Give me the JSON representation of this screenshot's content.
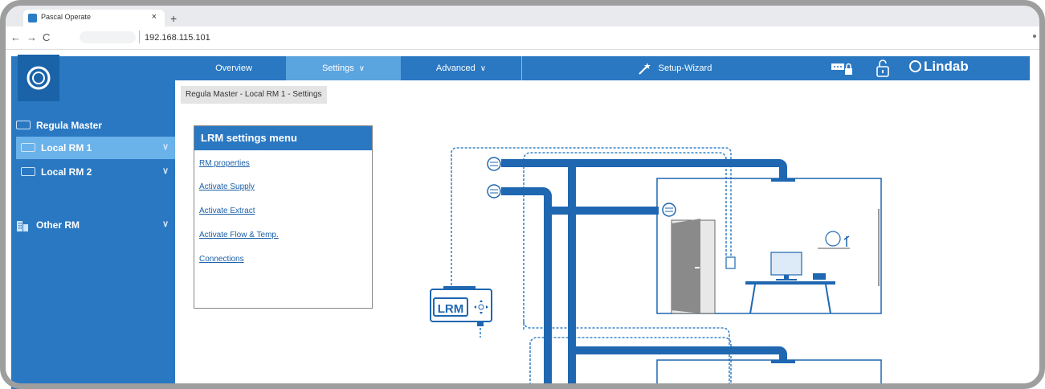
{
  "browser": {
    "tab_title": "Pascal Operate",
    "tab_close": "×",
    "new_tab": "+",
    "back": "←",
    "forward": "→",
    "reload": "C",
    "url": "192.168.115.101"
  },
  "topnav": {
    "items": [
      {
        "label": "Overview"
      },
      {
        "label": "Settings",
        "chevron": "∨"
      },
      {
        "label": "Advanced",
        "chevron": "∨"
      },
      {
        "label": "Setup-Wizard"
      }
    ],
    "brand": "Lindab"
  },
  "sidebar": {
    "master": "Regula Master",
    "items": [
      {
        "label": "Local RM 1",
        "chevron": "∨"
      },
      {
        "label": "Local RM 2",
        "chevron": "∨"
      },
      {
        "label": "Other RM",
        "chevron": "∨"
      }
    ]
  },
  "breadcrumb": "Regula Master - Local RM 1 - Settings",
  "settings_menu": {
    "title": "LRM settings menu",
    "links": [
      "RM properties",
      "Activate Supply",
      "Activate Extract",
      "Activate Flow & Temp.",
      "Connections"
    ]
  },
  "diagram": {
    "device_label": "LRM"
  },
  "colors": {
    "primary": "#2a78c2",
    "active_nav": "#5aa4df",
    "duct": "#1f67b1",
    "link": "#1a5fa8"
  }
}
